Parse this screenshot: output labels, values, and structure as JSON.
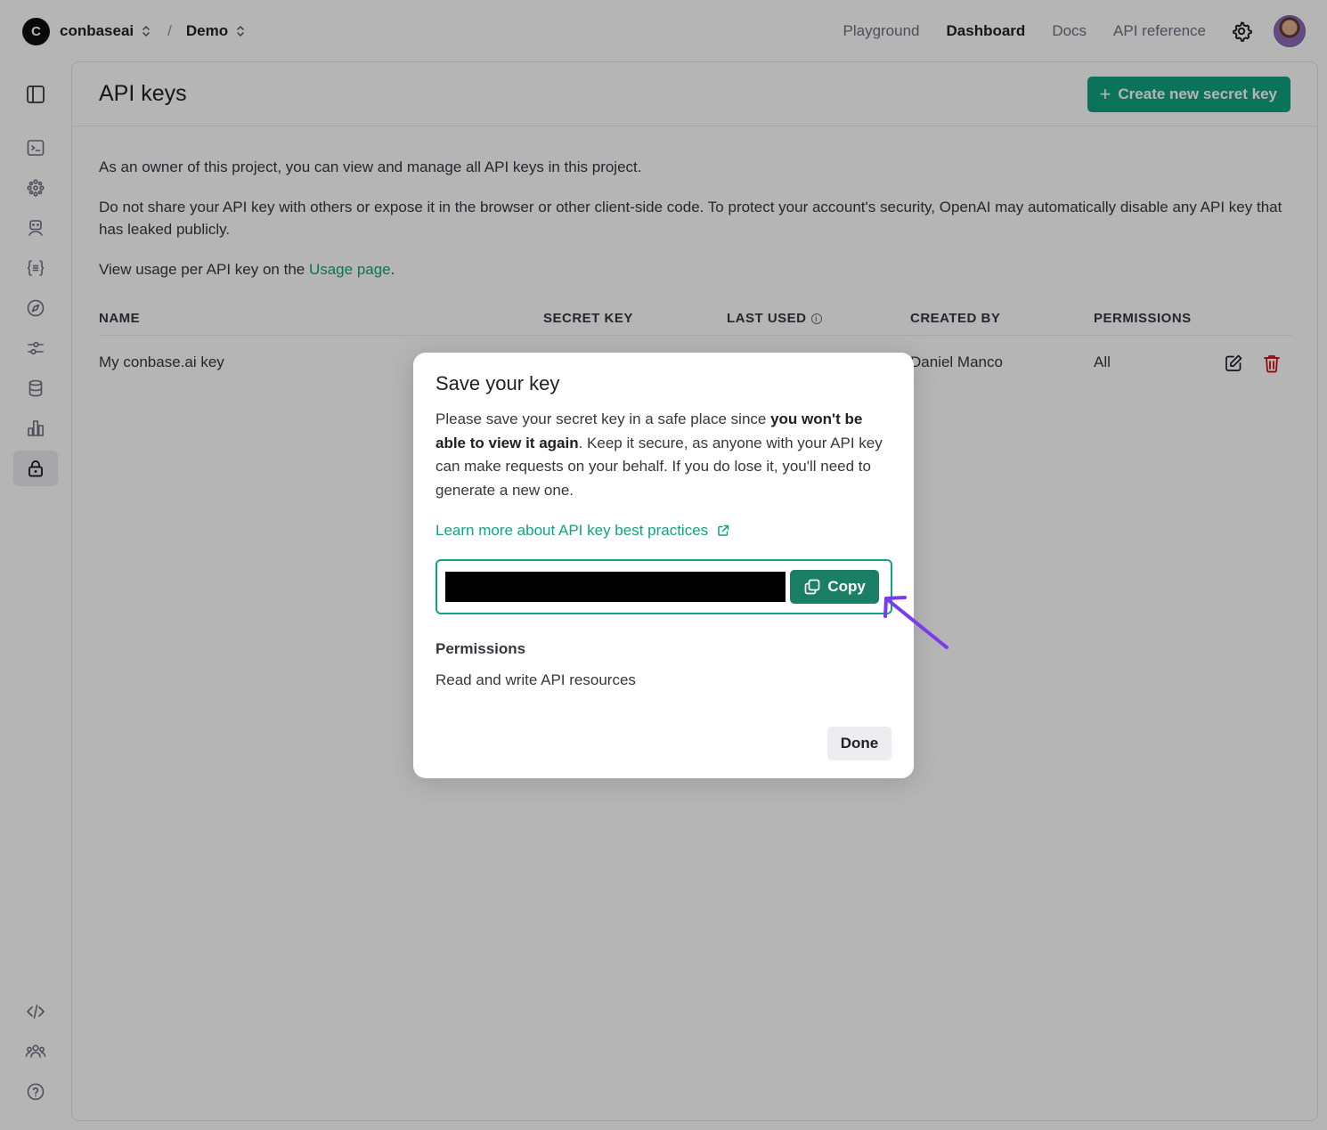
{
  "header": {
    "org_initial": "C",
    "org_name": "conbaseai",
    "separator": "/",
    "project_name": "Demo",
    "nav": [
      {
        "label": "Playground",
        "active": false
      },
      {
        "label": "Dashboard",
        "active": true
      },
      {
        "label": "Docs",
        "active": false
      },
      {
        "label": "API reference",
        "active": false
      }
    ]
  },
  "sidebar": {
    "items": [
      {
        "icon": "sidebar-toggle-icon"
      },
      {
        "icon": "terminal-icon"
      },
      {
        "icon": "cluster-icon"
      },
      {
        "icon": "assistant-robot-icon"
      },
      {
        "icon": "curly-braces-icon"
      },
      {
        "icon": "compass-icon"
      },
      {
        "icon": "sliders-icon"
      },
      {
        "icon": "database-icon"
      },
      {
        "icon": "bar-chart-icon"
      },
      {
        "icon": "lock-icon",
        "active": true
      }
    ],
    "bottom_items": [
      {
        "icon": "code-icon"
      },
      {
        "icon": "people-icon"
      },
      {
        "icon": "help-icon"
      }
    ]
  },
  "page": {
    "title": "API keys",
    "create_button": "Create new secret key",
    "intro": "As an owner of this project, you can view and manage all API keys in this project.",
    "warning": "Do not share your API key with others or expose it in the browser or other client-side code. To protect your account's security, OpenAI may automatically disable any API key that has leaked publicly.",
    "usage_prefix": "View usage per API key on the ",
    "usage_link": "Usage page",
    "usage_suffix": "."
  },
  "table": {
    "columns": [
      "NAME",
      "SECRET KEY",
      "LAST USED",
      "CREATED BY",
      "PERMISSIONS"
    ],
    "rows": [
      {
        "name": "My conbase.ai key",
        "created_by": "Daniel Manco",
        "permissions": "All"
      }
    ]
  },
  "modal": {
    "title": "Save your key",
    "text_before": "Please save your secret key in a safe place since ",
    "text_bold": "you won't be able to view it again",
    "text_after": ". Keep it secure, as anyone with your API key can make requests on your behalf. If you do lose it, you'll need to generate a new one.",
    "learn_link": "Learn more about API key best practices",
    "copy_label": "Copy",
    "permissions_label": "Permissions",
    "permissions_value": "Read and write API resources",
    "done_label": "Done"
  },
  "colors": {
    "accent": "#10a37f",
    "copy_button": "#1a7f64",
    "annotation_arrow": "#7c3aed",
    "delete": "#d00000"
  }
}
